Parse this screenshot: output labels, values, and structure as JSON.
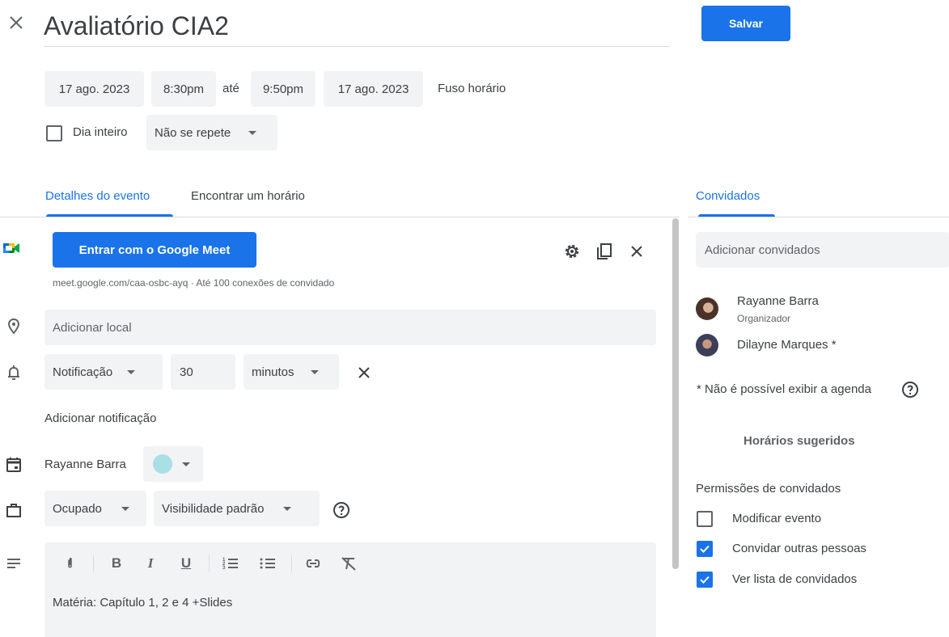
{
  "header": {
    "title": "Avaliatório CIA2",
    "save_label": "Salvar",
    "close_icon": "close-icon"
  },
  "datetime": {
    "start_date": "17 ago. 2023",
    "start_time": "8:30pm",
    "separator": "até",
    "end_time": "9:50pm",
    "end_date": "17 ago. 2023",
    "timezone_label": "Fuso horário",
    "all_day_label": "Dia inteiro",
    "all_day_checked": false,
    "repeat_value": "Não se repete"
  },
  "tabs": [
    {
      "label": "Detalhes do evento",
      "active": true
    },
    {
      "label": "Encontrar um horário",
      "active": false
    }
  ],
  "meet": {
    "button_label": "Entrar com o Google Meet",
    "link_text": "meet.google.com/caa-osbc-ayq · Até 100 conexões de convidado"
  },
  "location": {
    "placeholder": "Adicionar local"
  },
  "notification": {
    "type": "Notificação",
    "amount": "30",
    "unit": "minutos",
    "add_label": "Adicionar notificação"
  },
  "calendar": {
    "owner": "Rayanne Barra",
    "color": "#a8e0e6"
  },
  "availability": {
    "status": "Ocupado",
    "visibility": "Visibilidade padrão"
  },
  "description": {
    "text": "Matéria: Capítulo 1, 2 e 4 +Slides"
  },
  "guests": {
    "tab_label": "Convidados",
    "input_placeholder": "Adicionar convidados",
    "list": [
      {
        "name": "Rayanne Barra",
        "role": "Organizador"
      },
      {
        "name": "Dilayne Marques *",
        "role": ""
      }
    ],
    "agenda_note": "* Não é possível exibir a agenda",
    "suggested_times_label": "Horários sugeridos",
    "permissions_title": "Permissões de convidados",
    "permissions": [
      {
        "label": "Modificar evento",
        "checked": false
      },
      {
        "label": "Convidar outras pessoas",
        "checked": true
      },
      {
        "label": "Ver lista de convidados",
        "checked": true
      }
    ]
  },
  "colors": {
    "accent": "#1a73e8",
    "field_bg": "#f1f3f4",
    "text": "#3c4043"
  }
}
